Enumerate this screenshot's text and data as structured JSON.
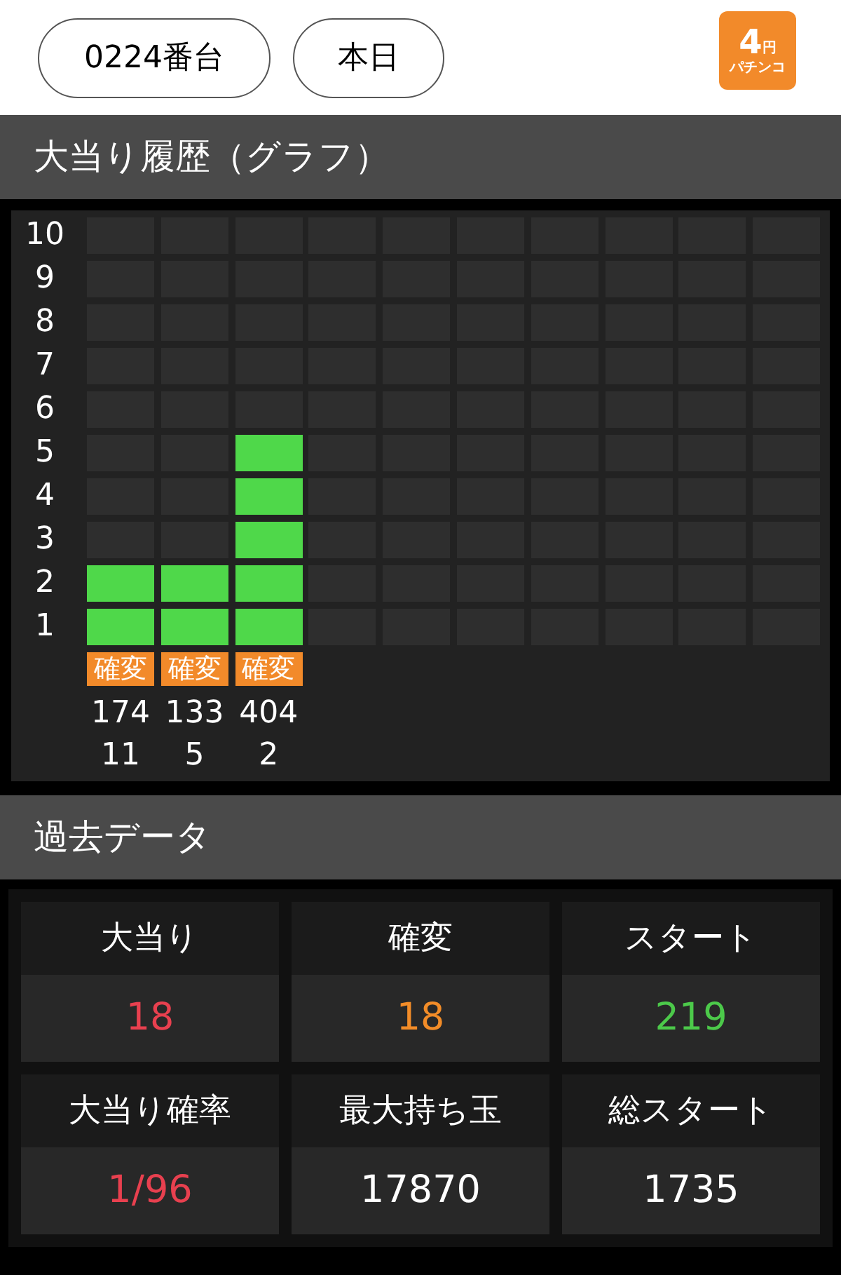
{
  "header": {
    "buttons": [
      {
        "label": "0224番台"
      },
      {
        "label": "本日"
      }
    ],
    "logo": {
      "value": "4",
      "unit": "円",
      "label": "パチンコ"
    }
  },
  "history": {
    "title": "大当り履歴（グラフ）",
    "rows": [
      {
        "label": "10",
        "cells": [
          {
            "filled": false
          },
          {
            "filled": false
          },
          {
            "filled": false
          },
          {
            "filled": false
          },
          {
            "filled": false
          },
          {
            "filled": false
          },
          {
            "filled": false
          },
          {
            "filled": false
          },
          {
            "filled": false
          },
          {
            "filled": false
          }
        ]
      },
      {
        "label": "9",
        "cells": [
          {
            "filled": false
          },
          {
            "filled": false
          },
          {
            "filled": false
          },
          {
            "filled": false
          },
          {
            "filled": false
          },
          {
            "filled": false
          },
          {
            "filled": false
          },
          {
            "filled": false
          },
          {
            "filled": false
          },
          {
            "filled": false
          }
        ]
      },
      {
        "label": "8",
        "cells": [
          {
            "filled": false
          },
          {
            "filled": false
          },
          {
            "filled": false
          },
          {
            "filled": false
          },
          {
            "filled": false
          },
          {
            "filled": false
          },
          {
            "filled": false
          },
          {
            "filled": false
          },
          {
            "filled": false
          },
          {
            "filled": false
          }
        ]
      },
      {
        "label": "7",
        "cells": [
          {
            "filled": false
          },
          {
            "filled": false
          },
          {
            "filled": false
          },
          {
            "filled": false
          },
          {
            "filled": false
          },
          {
            "filled": false
          },
          {
            "filled": false
          },
          {
            "filled": false
          },
          {
            "filled": false
          },
          {
            "filled": false
          }
        ]
      },
      {
        "label": "6",
        "cells": [
          {
            "filled": false
          },
          {
            "filled": false
          },
          {
            "filled": false
          },
          {
            "filled": false
          },
          {
            "filled": false
          },
          {
            "filled": false
          },
          {
            "filled": false
          },
          {
            "filled": false
          },
          {
            "filled": false
          },
          {
            "filled": false
          }
        ]
      },
      {
        "label": "5",
        "cells": [
          {
            "filled": false
          },
          {
            "filled": false
          },
          {
            "filled": true
          },
          {
            "filled": false
          },
          {
            "filled": false
          },
          {
            "filled": false
          },
          {
            "filled": false
          },
          {
            "filled": false
          },
          {
            "filled": false
          },
          {
            "filled": false
          }
        ]
      },
      {
        "label": "4",
        "cells": [
          {
            "filled": false
          },
          {
            "filled": false
          },
          {
            "filled": true
          },
          {
            "filled": false
          },
          {
            "filled": false
          },
          {
            "filled": false
          },
          {
            "filled": false
          },
          {
            "filled": false
          },
          {
            "filled": false
          },
          {
            "filled": false
          }
        ]
      },
      {
        "label": "3",
        "cells": [
          {
            "filled": false
          },
          {
            "filled": false
          },
          {
            "filled": true
          },
          {
            "filled": false
          },
          {
            "filled": false
          },
          {
            "filled": false
          },
          {
            "filled": false
          },
          {
            "filled": false
          },
          {
            "filled": false
          },
          {
            "filled": false
          }
        ]
      },
      {
        "label": "2",
        "cells": [
          {
            "filled": true
          },
          {
            "filled": true
          },
          {
            "filled": true
          },
          {
            "filled": false
          },
          {
            "filled": false
          },
          {
            "filled": false
          },
          {
            "filled": false
          },
          {
            "filled": false
          },
          {
            "filled": false
          },
          {
            "filled": false
          }
        ]
      },
      {
        "label": "1",
        "cells": [
          {
            "filled": true
          },
          {
            "filled": true
          },
          {
            "filled": true
          },
          {
            "filled": false
          },
          {
            "filled": false
          },
          {
            "filled": false
          },
          {
            "filled": false
          },
          {
            "filled": false
          },
          {
            "filled": false
          },
          {
            "filled": false
          }
        ]
      }
    ],
    "columns": [
      {
        "tag": "確変",
        "start": "174",
        "count": "11"
      },
      {
        "tag": "確変",
        "start": "133",
        "count": "5"
      },
      {
        "tag": "確変",
        "start": "404",
        "count": "2"
      }
    ]
  },
  "past": {
    "title": "過去データ",
    "stats": [
      {
        "label": "大当り",
        "value": "18",
        "color": "#e8404f"
      },
      {
        "label": "確変",
        "value": "18",
        "color": "#f28c28"
      },
      {
        "label": "スタート",
        "value": "219",
        "color": "#4cc94a"
      },
      {
        "label": "大当り確率",
        "value": "1/96",
        "color": "#e8404f"
      },
      {
        "label": "最大持ち玉",
        "value": "17870",
        "color": "#ffffff"
      },
      {
        "label": "総スタート",
        "value": "1735",
        "color": "#ffffff"
      }
    ]
  }
}
